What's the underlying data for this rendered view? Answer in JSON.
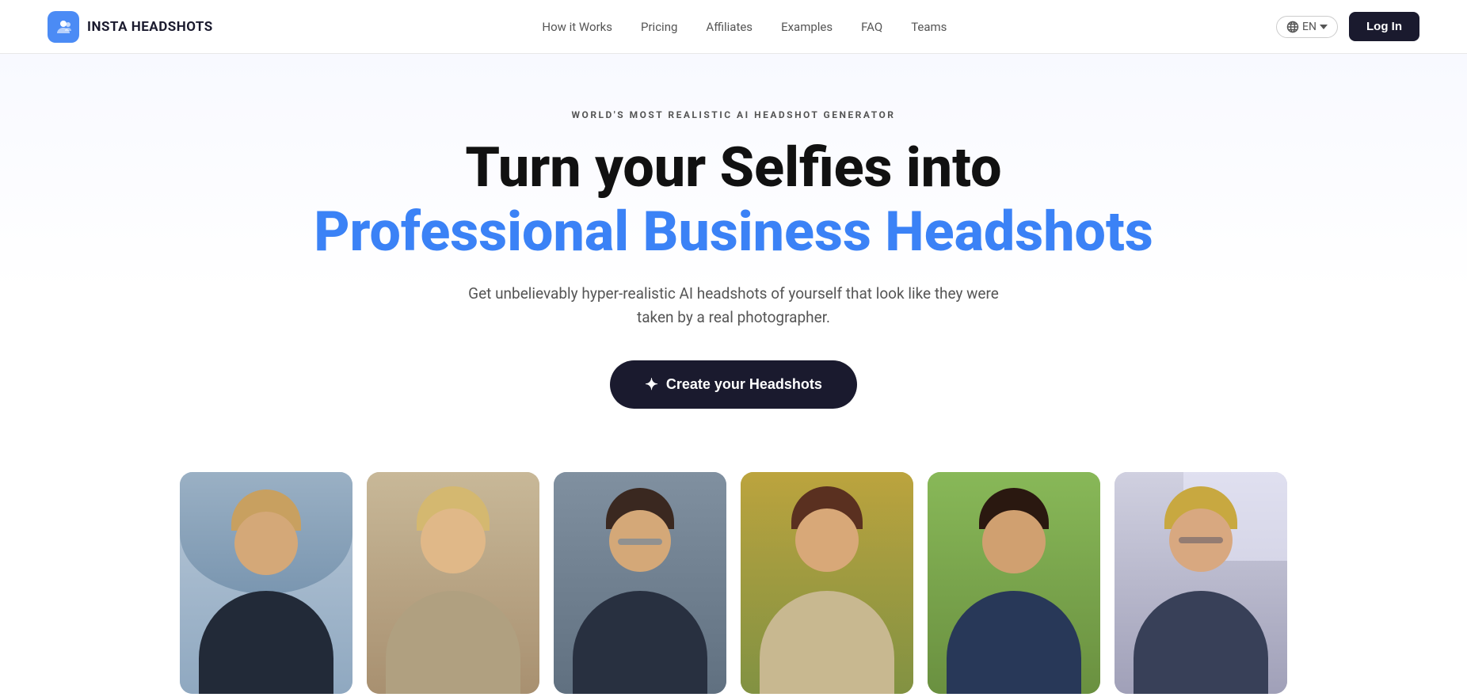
{
  "brand": {
    "name": "INSTA HEADSHOTS",
    "logo_alt": "Insta Headshots Logo"
  },
  "nav": {
    "links": [
      {
        "label": "How it Works",
        "href": "#"
      },
      {
        "label": "Pricing",
        "href": "#"
      },
      {
        "label": "Affiliates",
        "href": "#"
      },
      {
        "label": "Examples",
        "href": "#"
      },
      {
        "label": "FAQ",
        "href": "#"
      },
      {
        "label": "Teams",
        "href": "#"
      }
    ],
    "lang_label": "EN",
    "login_label": "Log In"
  },
  "hero": {
    "badge": "WORLD'S MOST REALISTIC AI HEADSHOT GENERATOR",
    "title_line1": "Turn your Selfies into",
    "title_line2": "Professional Business Headshots",
    "subtitle": "Get unbelievably hyper-realistic AI headshots of yourself that look like they were taken by a real photographer.",
    "cta_label": "Create your Headshots",
    "cta_sparkle": "✦"
  },
  "gallery": {
    "images": [
      {
        "id": "person-1",
        "skin": "fair",
        "hair": "blonde",
        "outfit": "dark",
        "bg": "city"
      },
      {
        "id": "person-2",
        "skin": "fair",
        "hair": "blonde",
        "outfit": "light",
        "bg": "indoor"
      },
      {
        "id": "person-3",
        "skin": "fair",
        "hair": "dark",
        "outfit": "suit",
        "bg": "ocean"
      },
      {
        "id": "person-4",
        "skin": "fair",
        "hair": "auburn",
        "outfit": "blazer",
        "bg": "autumn"
      },
      {
        "id": "person-5",
        "skin": "fair",
        "hair": "dark",
        "outfit": "navy",
        "bg": "park"
      },
      {
        "id": "person-6",
        "skin": "fair",
        "hair": "blonde",
        "outfit": "gray",
        "bg": "office"
      }
    ]
  },
  "colors": {
    "accent_blue": "#3B82F6",
    "nav_dark": "#1a1a2e",
    "logo_bg": "#4B8BF5"
  }
}
